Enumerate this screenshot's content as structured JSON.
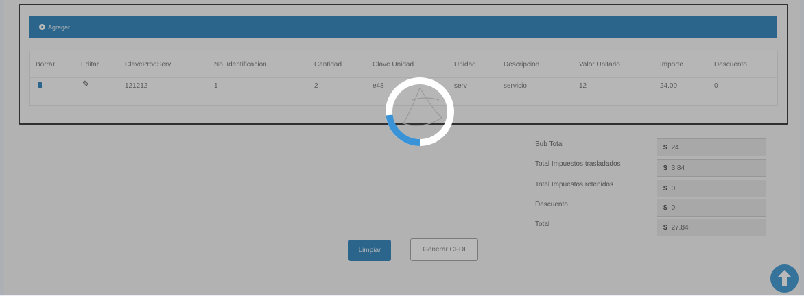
{
  "panel": {
    "header_title": "Agregar",
    "columns": [
      "Borrar",
      "Editar",
      "ClaveProdServ",
      "No. Identificacion",
      "Cantidad",
      "Clave Unidad",
      "Unidad",
      "Descripcion",
      "Valor Unitario",
      "Importe",
      "Descuento"
    ],
    "rows": [
      {
        "clave_prod_serv": "121212",
        "no_identificacion": "1",
        "cantidad": "2",
        "clave_unidad": "e48",
        "unidad": "serv",
        "descripcion": "servicio",
        "valor_unitario": "12",
        "importe": "24.00",
        "descuento": "0"
      }
    ]
  },
  "totals": {
    "currency": "$",
    "sub_total_label": "Sub Total",
    "sub_total_value": "24",
    "traslados_label": "Total Impuestos trasladados",
    "traslados_value": "3.84",
    "retenidos_label": "Total Impuestos retenidos",
    "retenidos_value": "0",
    "descuento_label": "Descuento",
    "descuento_value": "0",
    "total_label": "Total",
    "total_value": "27.84"
  },
  "actions": {
    "limpiar_label": "Limpiar",
    "generar_label": "Generar CFDI"
  },
  "colors": {
    "accent": "#1a78b6",
    "overlay": "rgba(70,70,70,0.38)",
    "spinner_progress": "#3a93d6",
    "spinner_track": "#ffffff"
  },
  "icons": {
    "header": "gear-icon",
    "delete": "trash-icon",
    "edit": "pencil-icon",
    "loading": "loading-spinner-icon",
    "scroll_top": "arrow-up-icon"
  }
}
